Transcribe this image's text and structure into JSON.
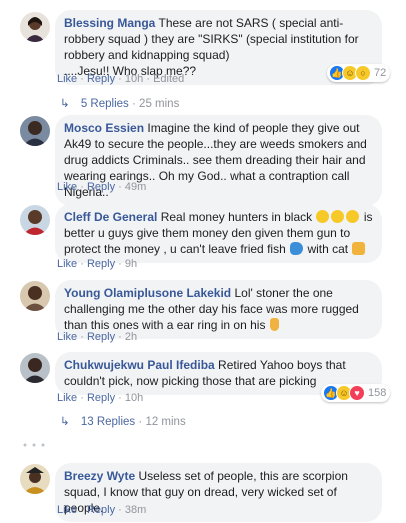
{
  "actions": {
    "like": "Like",
    "reply": "Reply",
    "sep": "·"
  },
  "colors": {
    "link": "#385898",
    "bubble": "#f2f3f5",
    "meta": "#90949c"
  },
  "comments": [
    {
      "author": "Blessing Manga",
      "text": "These are not SARS ( special anti-robbery squad ) they are \"SIRKS\" (special institution for robbery and kidnapping squad)",
      "text2": "....Jesu!! Who slap me??",
      "time": "10h",
      "edited": "Edited",
      "reactions": {
        "icons": [
          "like-icon",
          "haha-icon",
          "wow-icon"
        ],
        "count": "72"
      },
      "replies": {
        "label": "5 Replies",
        "time": "25 mins"
      }
    },
    {
      "author": "Mosco Essien",
      "text": "Imagine the kind of people they give out Ak49 to secure the people...they are weeds smokers and drug addicts Criminals.. see them dreading their hair and wearing earings.. Oh my God.. what a contraption call Nigeria..",
      "time": "49m"
    },
    {
      "author": "Cleff De General",
      "text_a": "Real money hunters in black",
      "text_b": "is better u guys give them money den given them gun to protect the money , u can't leave fried fish",
      "text_c": "with cat",
      "time": "9h"
    },
    {
      "author": "Young Olamiplusone Lakekid",
      "text": "Lol' stoner the one challenging me the other day his face was more rugged than this ones with a ear ring in on his",
      "time": "2h"
    },
    {
      "author": "Chukwujekwu Paul Ifediba",
      "text": "Retired Yahoo boys that couldn't pick, now picking those that are picking",
      "time": "10h",
      "reactions": {
        "icons": [
          "like-icon",
          "haha-icon",
          "love-icon"
        ],
        "count": "158"
      },
      "replies": {
        "label": "13 Replies",
        "time": "12 mins"
      }
    },
    {
      "author": "Breezy Wyte",
      "text": "Useless set of people, this are scorpion squad, I know that guy on dread, very wicked set of people.",
      "time": "38m"
    }
  ]
}
